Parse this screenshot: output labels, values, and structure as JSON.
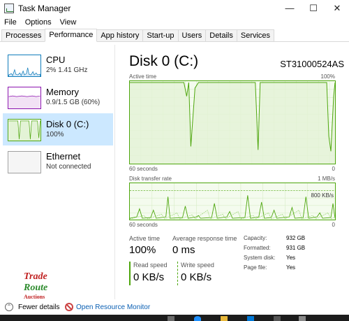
{
  "window": {
    "title": "Task Manager",
    "controls": {
      "minimize": "—",
      "maximize": "☐",
      "close": "✕"
    }
  },
  "menu": [
    "File",
    "Options",
    "View"
  ],
  "tabs": [
    "Processes",
    "Performance",
    "App history",
    "Start-up",
    "Users",
    "Details",
    "Services"
  ],
  "active_tab": "Performance",
  "sidebar": {
    "items": [
      {
        "name": "CPU",
        "sub": "2%  1.41 GHz",
        "color": "#117dbb"
      },
      {
        "name": "Memory",
        "sub": "0.9/1.5 GB (60%)",
        "color": "#8b12ae"
      },
      {
        "name": "Disk 0 (C:)",
        "sub": "100%",
        "color": "#4da60c"
      },
      {
        "name": "Ethernet",
        "sub": "Not connected",
        "color": "#a0a0a0"
      }
    ],
    "selected": "Disk 0 (C:)"
  },
  "disk": {
    "title": "Disk 0 (C:)",
    "model": "ST31000524AS",
    "active_time_label": "Active time",
    "active_time_max": "100%",
    "active_time_span": "60 seconds",
    "active_time_min": "0",
    "transfer_label": "Disk transfer rate",
    "transfer_max": "1 MB/s",
    "transfer_marker": "800 KB/s",
    "transfer_span": "60 seconds",
    "transfer_min": "0",
    "active_time_series": [
      100,
      100,
      100,
      100,
      100,
      100,
      100,
      100,
      100,
      100,
      100,
      100,
      100,
      100,
      100,
      100,
      100,
      100,
      100,
      100,
      100,
      100,
      100,
      100,
      100,
      100,
      100,
      100,
      100,
      100,
      100,
      100,
      100,
      100,
      100,
      100,
      100,
      100,
      100,
      100,
      100,
      100,
      100,
      100,
      100,
      100,
      100,
      100,
      100,
      100
    ],
    "stats": {
      "active_time_label": "Active time",
      "active_time_value": "100%",
      "avg_response_label": "Average response time",
      "avg_response_value": "0 ms",
      "read_speed_label": "Read speed",
      "read_speed_value": "0 KB/s",
      "write_speed_label": "Write speed",
      "write_speed_value": "0 KB/s"
    },
    "details": [
      {
        "label": "Capacity:",
        "value": "932 GB"
      },
      {
        "label": "Formatted:",
        "value": "931 GB"
      },
      {
        "label": "System disk:",
        "value": "Yes"
      },
      {
        "label": "Page file:",
        "value": "Yes"
      }
    ]
  },
  "logo": {
    "line1": "Trade",
    "line2": "Route",
    "line3": "Auctions"
  },
  "footer": {
    "fewer_details": "Fewer details",
    "resource_monitor": "Open Resource Monitor"
  },
  "colors": {
    "disk_green": "#4da60c",
    "graph_fill": "#f4fbee",
    "selection": "#cce8ff",
    "link": "#0a5fb3"
  }
}
